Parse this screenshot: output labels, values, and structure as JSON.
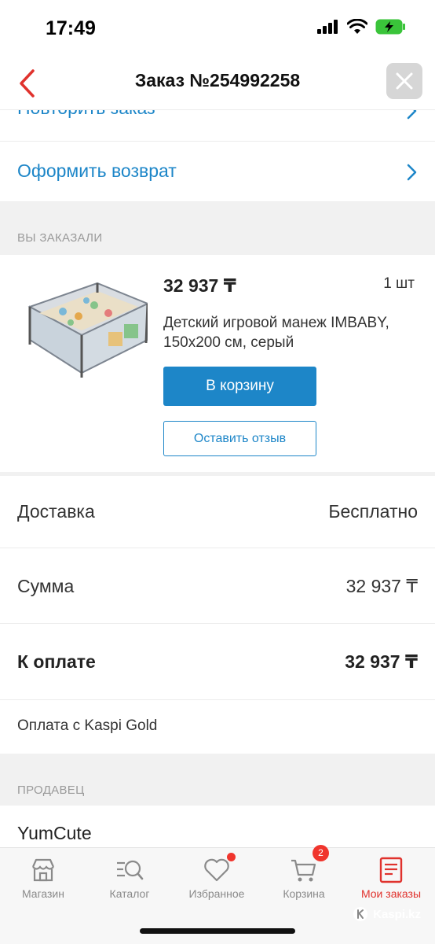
{
  "status": {
    "time": "17:49"
  },
  "nav": {
    "title": "Заказ №254992258"
  },
  "actions": {
    "repeat": "Повторить заказ",
    "return": "Оформить возврат"
  },
  "ordered": {
    "header": "ВЫ ЗАКАЗАЛИ",
    "product": {
      "price": "32 937 ₸",
      "qty": "1 шт",
      "name": "Детский игровой манеж IMBABY, 150x200 см, серый",
      "cart_button": "В корзину",
      "review_button": "Оставить отзыв"
    }
  },
  "summary": [
    {
      "label": "Доставка",
      "value": "Бесплатно"
    },
    {
      "label": "Сумма",
      "value": "32 937 ₸"
    },
    {
      "label": "К оплате",
      "value": "32 937 ₸"
    }
  ],
  "payment": {
    "method": "Оплата с Kaspi Gold"
  },
  "seller": {
    "header": "ПРОДАВЕЦ",
    "name": "YumCute"
  },
  "tabs": [
    {
      "label": "Магазин",
      "icon": "store-icon",
      "active": false
    },
    {
      "label": "Каталог",
      "icon": "catalog-search-icon",
      "active": false
    },
    {
      "label": "Избранное",
      "icon": "heart-icon",
      "active": false,
      "dot": true
    },
    {
      "label": "Корзина",
      "icon": "cart-icon",
      "active": false,
      "badge": "2"
    },
    {
      "label": "Мои заказы",
      "icon": "orders-icon",
      "active": true
    }
  ],
  "watermark": "Kaspi.kz",
  "colors": {
    "accent": "#1d86c8",
    "brand_red": "#e0322d",
    "section_bg": "#f1f1f1"
  }
}
